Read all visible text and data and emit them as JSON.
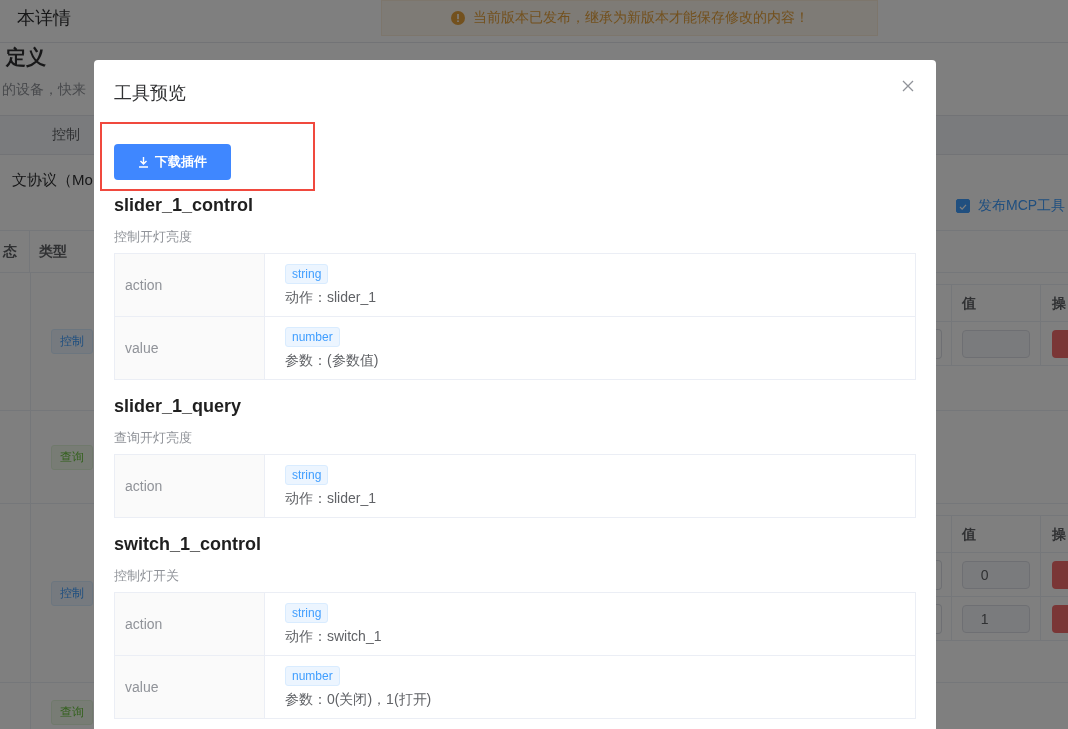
{
  "page": {
    "title": "本详情",
    "notice": "当前版本已发布，继承为新版本才能保存修改的内容！",
    "section_title": "定义",
    "description": "的设备，快来",
    "tabs": [
      {
        "label": "控制",
        "selected": false
      }
    ],
    "protocol": "文协议（Mo",
    "publish_mcp": {
      "label": "发布MCP工具",
      "checked": true
    },
    "table": {
      "columns": [
        "态",
        "类型"
      ],
      "rows": [
        {
          "type": "控制",
          "kind": "control",
          "params": {
            "columns": [
              "值",
              "操"
            ],
            "values": [
              {
                "kind": "blank"
              }
            ]
          }
        },
        {
          "type": "查询",
          "kind": "query"
        },
        {
          "type": "控制",
          "kind": "control",
          "params": {
            "columns": [
              "值",
              "操"
            ],
            "values": [
              {
                "kind": "filled",
                "value": "0"
              },
              {
                "kind": "filled",
                "value": "1"
              }
            ]
          }
        },
        {
          "type": "查询",
          "kind": "query"
        }
      ]
    }
  },
  "dialog": {
    "title": "工具预览",
    "download_button": {
      "label": "下载插件",
      "highlighted": true
    },
    "tools": [
      {
        "name": "slider_1_control",
        "description": "控制开灯亮度",
        "params": [
          {
            "name": "action",
            "type": "string",
            "description": "动作：slider_1"
          },
          {
            "name": "value",
            "type": "number",
            "description": "参数：(参数值)"
          }
        ]
      },
      {
        "name": "slider_1_query",
        "description": "查询开灯亮度",
        "params": [
          {
            "name": "action",
            "type": "string",
            "description": "动作：slider_1"
          }
        ]
      },
      {
        "name": "switch_1_control",
        "description": "控制灯开关",
        "params": [
          {
            "name": "action",
            "type": "string",
            "description": "动作：switch_1"
          },
          {
            "name": "value",
            "type": "number",
            "description": "参数：0(关闭)，1(打开)"
          }
        ]
      }
    ]
  }
}
